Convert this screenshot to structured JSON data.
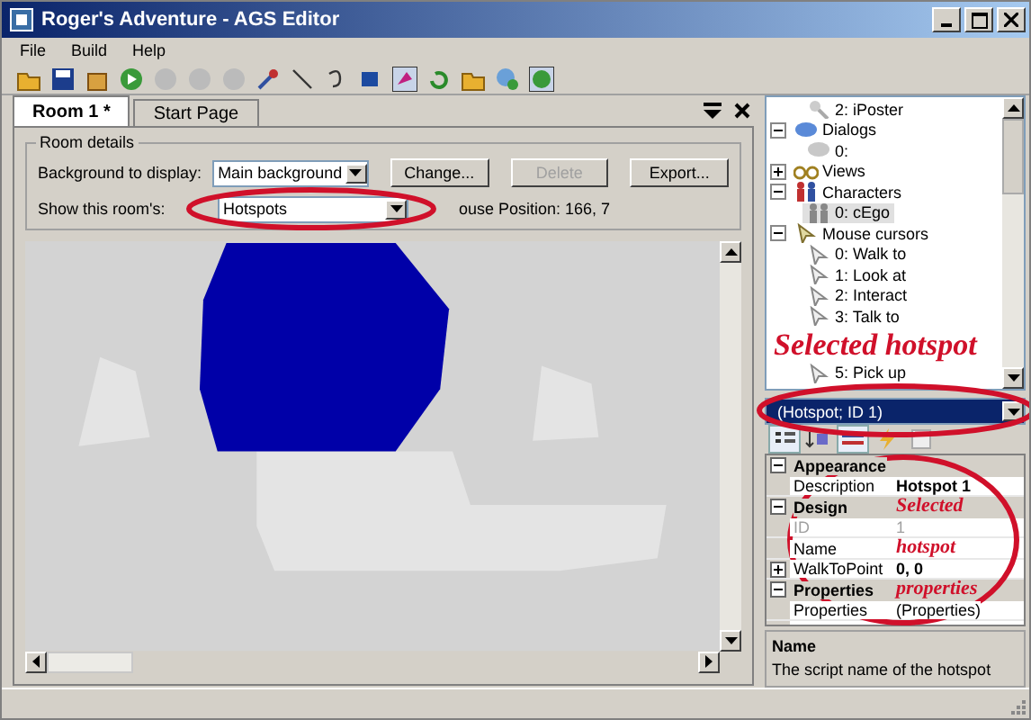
{
  "window": {
    "title": "Roger's Adventure - AGS Editor"
  },
  "menu": [
    {
      "label": "File"
    },
    {
      "label": "Build"
    },
    {
      "label": "Help"
    }
  ],
  "tabs": [
    {
      "label": "Room 1 *",
      "selected": true
    },
    {
      "label": "Start Page",
      "selected": false
    }
  ],
  "room_details": {
    "title": "Room details",
    "background_label": "Background to display:",
    "background_value": "Main background",
    "show_label": "Show this room's:",
    "show_value": "Hotspots",
    "mouse_position": "ouse Position: 166, 7",
    "buttons": [
      {
        "label": "Change...",
        "disabled": false
      },
      {
        "label": "Delete",
        "disabled": true
      },
      {
        "label": "Export...",
        "disabled": false
      }
    ]
  },
  "tree": {
    "continued": [
      {
        "label": "2: iPoster",
        "kind": "inventory",
        "selected": false
      }
    ],
    "items": [
      {
        "label": "Dialogs",
        "kind": "dialog",
        "expanded": true,
        "selected": false,
        "children": [
          {
            "label": "0:",
            "kind": "dialog",
            "selected": false
          }
        ]
      },
      {
        "label": "Views",
        "kind": "view",
        "expanded": false,
        "selected": false
      },
      {
        "label": "Characters",
        "kind": "character",
        "expanded": true,
        "selected": false,
        "children": [
          {
            "label": "0: cEgo",
            "kind": "character",
            "selected": true
          }
        ]
      },
      {
        "label": "Mouse cursors",
        "kind": "cursor",
        "expanded": true,
        "selected": false,
        "children": [
          {
            "label": "0: Walk to",
            "kind": "cursor",
            "selected": false
          },
          {
            "label": "1: Look at",
            "kind": "cursor",
            "selected": false
          },
          {
            "label": "2: Interact",
            "kind": "cursor",
            "selected": false
          },
          {
            "label": "3: Talk to",
            "kind": "cursor",
            "selected": false
          },
          {
            "label": "5: Pick up",
            "kind": "cursor",
            "selected": false
          }
        ]
      }
    ]
  },
  "object_selector": {
    "value": "(Hotspot; ID 1)"
  },
  "properties": [
    {
      "category": "Appearance",
      "expanded": true,
      "rows": [
        {
          "name": "Description",
          "value": "Hotspot 1",
          "bold": true,
          "disabled": false
        }
      ]
    },
    {
      "category": "Design",
      "expanded": true,
      "rows": [
        {
          "name": "ID",
          "value": "1",
          "bold": false,
          "disabled": true
        },
        {
          "name": "Name",
          "disabled": false
        },
        {
          "name": "WalkToPoint",
          "value": "0, 0",
          "bold": true,
          "disabled": false,
          "expandable": true
        }
      ]
    },
    {
      "category": "Properties",
      "expanded": true,
      "rows": [
        {
          "name": "Properties",
          "value": "(Properties)",
          "bold": false,
          "disabled": false
        }
      ]
    }
  ],
  "description": {
    "title": "Name",
    "text": "The script name of the hotspot"
  },
  "annotations": [
    {
      "text": "Selected hotspot"
    },
    {
      "lines": [
        "Selected",
        "hotspot",
        "properties"
      ]
    }
  ]
}
